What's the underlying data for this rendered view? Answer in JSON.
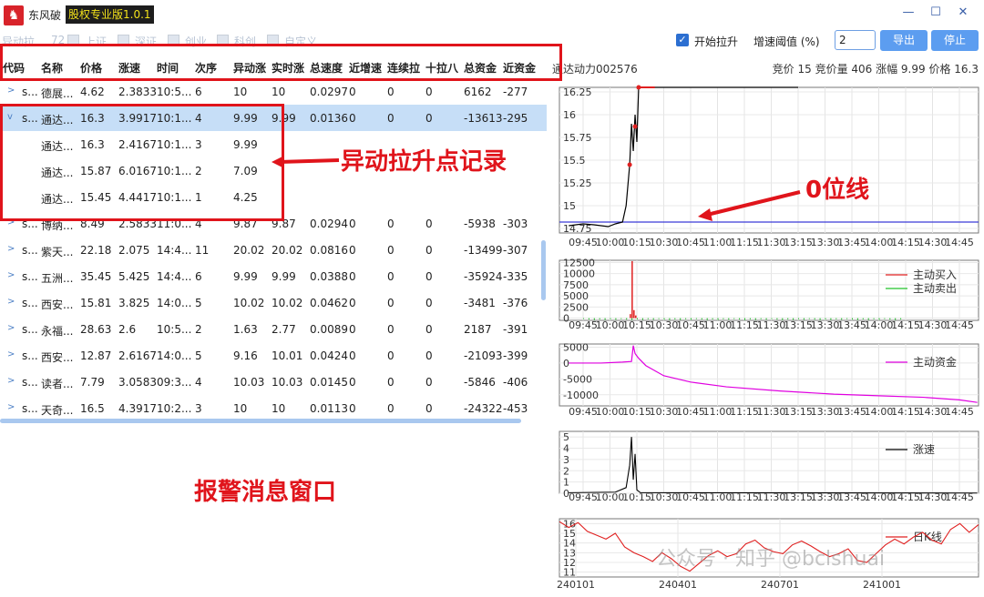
{
  "app": {
    "logo_glyph": "♞",
    "name": "东风破",
    "version": "股权专业版1.0.1"
  },
  "window_controls": {
    "minimize": "—",
    "maximize": "☐",
    "close": "✕"
  },
  "toolbar": {
    "faded_label": "异动拉",
    "faded_count": "72",
    "filters": [
      "上证",
      "深证",
      "创业",
      "科创",
      "自定义"
    ],
    "start_label": "开始拉升",
    "start_checked": "✓",
    "threshold_label": "增速阈值 (%)",
    "threshold_value": "2",
    "export_label": "导出",
    "stop_label": "停止"
  },
  "table": {
    "columns": [
      "代码",
      "名称",
      "价格",
      "涨速",
      "时间",
      "次序",
      "异动涨",
      "实时涨",
      "总速度",
      "近增速",
      "连续拉",
      "十拉八",
      "总资金",
      "近资金"
    ],
    "rows": [
      {
        "arrow": ">",
        "code": "s...",
        "name": "德展...",
        "price": "4.62",
        "speed": "2.3833",
        "time": "10:5...",
        "order": "6",
        "abn": "10",
        "rt": "10",
        "total_speed": "0.0297",
        "near_speed": "0",
        "cont": "0",
        "ten8": "0",
        "fund": "6162",
        "near_fund": "-277"
      },
      {
        "arrow": "v",
        "code": "s...",
        "name": "通达...",
        "price": "16.3",
        "speed": "3.9917",
        "time": "10:1...",
        "order": "4",
        "abn": "9.99",
        "rt": "9.99",
        "total_speed": "0.0136",
        "near_speed": "0",
        "cont": "0",
        "ten8": "0",
        "fund": "-13613",
        "near_fund": "-295"
      },
      {
        "arrow": "",
        "code": "",
        "name": "通达...",
        "price": "16.3",
        "speed": "2.4167",
        "time": "10:1...",
        "order": "3",
        "abn": "9.99",
        "rt": "",
        "total_speed": "",
        "near_speed": "",
        "cont": "",
        "ten8": "",
        "fund": "",
        "near_fund": ""
      },
      {
        "arrow": "",
        "code": "",
        "name": "通达...",
        "price": "15.87",
        "speed": "6.0167",
        "time": "10:1...",
        "order": "2",
        "abn": "7.09",
        "rt": "",
        "total_speed": "",
        "near_speed": "",
        "cont": "",
        "ten8": "",
        "fund": "",
        "near_fund": ""
      },
      {
        "arrow": "",
        "code": "",
        "name": "通达...",
        "price": "15.45",
        "speed": "4.4417",
        "time": "10:1...",
        "order": "1",
        "abn": "4.25",
        "rt": "",
        "total_speed": "",
        "near_speed": "",
        "cont": "",
        "ten8": "",
        "fund": "",
        "near_fund": ""
      },
      {
        "arrow": ">",
        "code": "s...",
        "name": "博纳...",
        "price": "8.49",
        "speed": "2.5833",
        "time": "11:0...",
        "order": "4",
        "abn": "9.87",
        "rt": "9.87",
        "total_speed": "0.0294",
        "near_speed": "0",
        "cont": "0",
        "ten8": "0",
        "fund": "-5938",
        "near_fund": "-303"
      },
      {
        "arrow": ">",
        "code": "s...",
        "name": "紫天...",
        "price": "22.18",
        "speed": "2.075",
        "time": "14:4...",
        "order": "11",
        "abn": "20.02",
        "rt": "20.02",
        "total_speed": "0.0816",
        "near_speed": "0",
        "cont": "0",
        "ten8": "0",
        "fund": "-13499",
        "near_fund": "-307"
      },
      {
        "arrow": ">",
        "code": "s...",
        "name": "五洲...",
        "price": "35.45",
        "speed": "5.425",
        "time": "14:4...",
        "order": "6",
        "abn": "9.99",
        "rt": "9.99",
        "total_speed": "0.0388",
        "near_speed": "0",
        "cont": "0",
        "ten8": "0",
        "fund": "-35924",
        "near_fund": "-335"
      },
      {
        "arrow": ">",
        "code": "s...",
        "name": "西安...",
        "price": "15.81",
        "speed": "3.825",
        "time": "14:0...",
        "order": "5",
        "abn": "10.02",
        "rt": "10.02",
        "total_speed": "0.0462",
        "near_speed": "0",
        "cont": "0",
        "ten8": "0",
        "fund": "-3481",
        "near_fund": "-376"
      },
      {
        "arrow": ">",
        "code": "s...",
        "name": "永福...",
        "price": "28.63",
        "speed": "2.6",
        "time": "10:5...",
        "order": "2",
        "abn": "1.63",
        "rt": "2.77",
        "total_speed": "0.0089",
        "near_speed": "0",
        "cont": "0",
        "ten8": "0",
        "fund": "2187",
        "near_fund": "-391"
      },
      {
        "arrow": ">",
        "code": "s...",
        "name": "西安...",
        "price": "12.87",
        "speed": "2.6167",
        "time": "14:0...",
        "order": "5",
        "abn": "9.16",
        "rt": "10.01",
        "total_speed": "0.0424",
        "near_speed": "0",
        "cont": "0",
        "ten8": "0",
        "fund": "-21093",
        "near_fund": "-399"
      },
      {
        "arrow": ">",
        "code": "s...",
        "name": "读者...",
        "price": "7.79",
        "speed": "3.0583",
        "time": "09:3...",
        "order": "4",
        "abn": "10.03",
        "rt": "10.03",
        "total_speed": "0.0145",
        "near_speed": "0",
        "cont": "0",
        "ten8": "0",
        "fund": "-5846",
        "near_fund": "-406"
      },
      {
        "arrow": ">",
        "code": "s...",
        "name": "天奇...",
        "price": "16.5",
        "speed": "4.3917",
        "time": "10:2...",
        "order": "3",
        "abn": "10",
        "rt": "10",
        "total_speed": "0.0113",
        "near_speed": "0",
        "cont": "0",
        "ten8": "0",
        "fund": "-24322",
        "near_fund": "-453"
      }
    ]
  },
  "stock": {
    "title": "通达动力002576",
    "info": "竞价 15 竞价量 406 涨幅 9.99 价格 16.3"
  },
  "annotations": {
    "record_label": "异动拉升点记录",
    "zero_line_label": "0位线",
    "alarm_window_label": "报警消息窗口"
  },
  "watermark": "公众号 · 知乎 @bclshuai",
  "chart_data": [
    {
      "type": "line",
      "title": "",
      "x_ticks": [
        "09:45",
        "10:00",
        "10:15",
        "10:30",
        "10:45",
        "11:00",
        "11:15",
        "11:30",
        "13:15",
        "13:30",
        "13:45",
        "14:00",
        "14:15",
        "14:30",
        "14:45"
      ],
      "y_ticks": [
        "16.25",
        "16",
        "15.75",
        "15.5",
        "15.25",
        "15",
        "14.75"
      ],
      "ylim": [
        14.7,
        16.3
      ],
      "zero_line": 14.82,
      "markers": [
        {
          "x": "10:13",
          "y": 15.45
        },
        {
          "x": "10:14",
          "y": 15.87
        },
        {
          "x": "10:15",
          "y": 16.3
        }
      ],
      "colors": {
        "line": "#000000",
        "zero_line": "#3b3bd8",
        "marker": "#e02020"
      }
    },
    {
      "type": "bar",
      "x_ticks": [
        "09:45",
        "10:00",
        "10:15",
        "10:30",
        "10:45",
        "11:00",
        "11:15",
        "11:30",
        "13:15",
        "13:30",
        "13:45",
        "14:00",
        "14:15",
        "14:30",
        "14:45"
      ],
      "y_ticks": [
        "12500",
        "10000",
        "7500",
        "5000",
        "2500",
        "0"
      ],
      "ylim": [
        -500,
        13000
      ],
      "series": [
        {
          "name": "主动买入",
          "color": "#e02020"
        },
        {
          "name": "主动卖出",
          "color": "#22c22a"
        }
      ]
    },
    {
      "type": "line",
      "x_ticks": [
        "09:45",
        "10:00",
        "10:15",
        "10:30",
        "10:45",
        "11:00",
        "11:15",
        "11:30",
        "13:15",
        "13:30",
        "13:45",
        "14:00",
        "14:15",
        "14:30",
        "14:45"
      ],
      "y_ticks": [
        "5000",
        "0",
        "-5000",
        "-10000"
      ],
      "ylim": [
        -13500,
        6000
      ],
      "series": [
        {
          "name": "主动资金",
          "color": "#e000e0"
        }
      ]
    },
    {
      "type": "line",
      "x_ticks": [
        "09:45",
        "10:00",
        "10:15",
        "10:30",
        "10:45",
        "11:00",
        "11:15",
        "11:30",
        "13:15",
        "13:30",
        "13:45",
        "14:00",
        "14:15",
        "14:30",
        "14:45"
      ],
      "y_ticks": [
        "5",
        "4",
        "3",
        "2",
        "1",
        "0"
      ],
      "ylim": [
        0,
        5.5
      ],
      "series": [
        {
          "name": "涨速",
          "color": "#000000"
        }
      ]
    },
    {
      "type": "line",
      "x_ticks": [
        "240101",
        "240401",
        "240701",
        "241001"
      ],
      "y_ticks": [
        "16",
        "15",
        "14",
        "13",
        "12",
        "11"
      ],
      "ylim": [
        10.5,
        16.5
      ],
      "series": [
        {
          "name": "日K线",
          "color": "#e02020"
        }
      ]
    }
  ]
}
